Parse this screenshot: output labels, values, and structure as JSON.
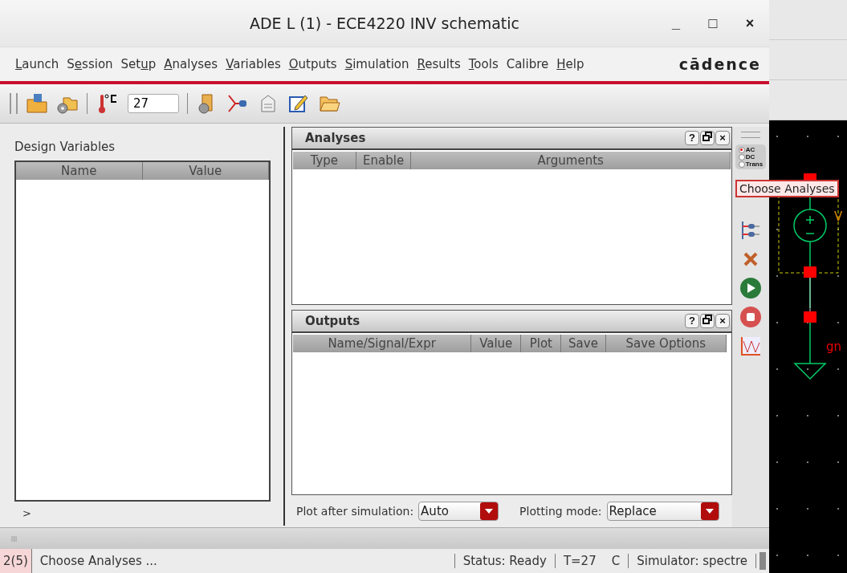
{
  "window": {
    "title": "ADE L (1) - ECE4220 INV schematic",
    "controls": [
      "_",
      "□",
      "×"
    ]
  },
  "menu": [
    {
      "access_key": "L",
      "rest": "aunch"
    },
    {
      "lead": "S",
      "access_key": "e",
      "rest": "ssion"
    },
    {
      "lead": "Set",
      "access_key": "u",
      "rest": "p"
    },
    {
      "access_key": "A",
      "rest": "nalyses"
    },
    {
      "access_key": "V",
      "rest": "ariables"
    },
    {
      "access_key": "O",
      "rest": "utputs"
    },
    {
      "access_key": "S",
      "rest": "imulation"
    },
    {
      "access_key": "R",
      "rest": "esults"
    },
    {
      "access_key": "T",
      "rest": "ools"
    },
    {
      "lead": "Calibre"
    },
    {
      "access_key": "H",
      "rest": "elp"
    }
  ],
  "logo": "cādence",
  "toolbar": {
    "temperature": "27"
  },
  "design_variables": {
    "title": "Design Variables",
    "columns": [
      "Name",
      "Value"
    ],
    "prompt": ">"
  },
  "analyses": {
    "title": "Analyses",
    "columns": [
      "Type",
      "Enable",
      "Arguments"
    ]
  },
  "outputs": {
    "title": "Outputs",
    "columns": [
      "Name/Signal/Expr",
      "Value",
      "Plot",
      "Save",
      "Save Options"
    ]
  },
  "panel_buttons": [
    "?",
    "×"
  ],
  "plot_after": {
    "label": "Plot after simulation:",
    "value": "Auto"
  },
  "plotting_mode": {
    "label": "Plotting mode:",
    "value": "Replace"
  },
  "analysis_radio": [
    {
      "label": "AC",
      "selected": true
    },
    {
      "label": "DC",
      "selected": false
    },
    {
      "label": "Trans",
      "selected": false
    }
  ],
  "tooltip": "Choose Analyses",
  "status_bar": {
    "count": "2(5)",
    "message": "Choose Analyses ...",
    "status": "Status: Ready",
    "temp": "T=27",
    "unit": "C",
    "simulator": "Simulator: spectre"
  },
  "schematic": {
    "labels": [
      "V",
      "gn"
    ]
  }
}
